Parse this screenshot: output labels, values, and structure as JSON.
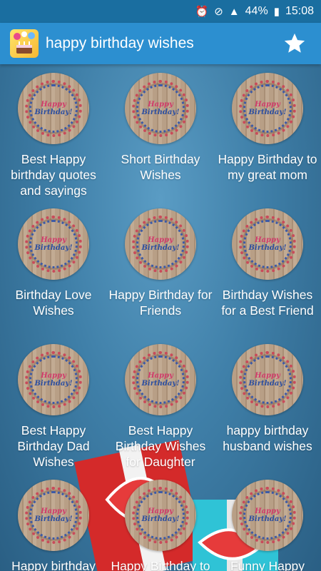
{
  "status_bar": {
    "battery": "44%",
    "time": "15:08"
  },
  "app_bar": {
    "title": "happy birthday wishes",
    "icon": "birthday-cake-icon",
    "favorite_icon": "star-icon"
  },
  "badge": {
    "line1": "Happy",
    "line2": "Birthday!"
  },
  "items": [
    {
      "label": "Best Happy birthday quotes and sayings"
    },
    {
      "label": "Short Birthday Wishes"
    },
    {
      "label": "Happy Birthday to my great mom"
    },
    {
      "label": "Birthday Love Wishes"
    },
    {
      "label": "Happy Birthday for Friends"
    },
    {
      "label": "Birthday Wishes for a Best Friend"
    },
    {
      "label": "Best Happy Birthday Dad Wishes"
    },
    {
      "label": "Best Happy Birthday Wishes for Daughter"
    },
    {
      "label": "happy birthday husband wishes"
    },
    {
      "label": "Happy birthday"
    },
    {
      "label": "Happy Birthday to"
    },
    {
      "label": "Funny Happy"
    }
  ],
  "colors": {
    "status_bar": "#1a6ea0",
    "app_bar": "#2c8fd0",
    "background": "#3f7fa8"
  }
}
